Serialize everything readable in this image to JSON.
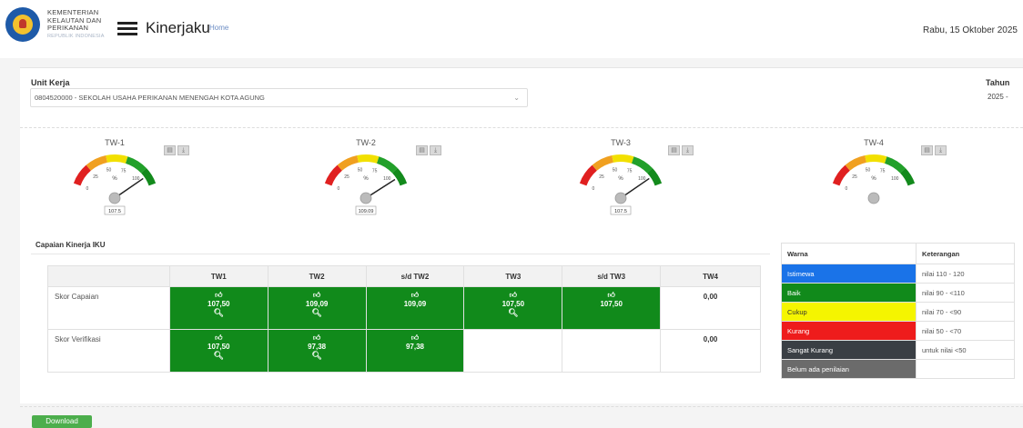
{
  "header": {
    "ministry_line1": "KEMENTERIAN",
    "ministry_line2": "KELAUTAN DAN",
    "ministry_line3": "PERIKANAN",
    "ministry_sub": "REPUBLIK INDONESIA",
    "app_title": "Kinerjaku",
    "breadcrumb": "Home",
    "date": "Rabu, 15 Oktober 2025",
    "icons": {
      "logo": "kkp-logo",
      "menu": "hamburger-menu-icon"
    }
  },
  "filters": {
    "unit_label": "Unit Kerja",
    "unit_value": "0804520000 - SEKOLAH USAHA PERIKANAN MENENGAH KOTA AGUNG",
    "tahun_label": "Tahun",
    "tahun_value": "2025 -"
  },
  "gauges": [
    {
      "title": "TW-1",
      "value": 107.5,
      "label": "107.5",
      "unit": "%",
      "ticks": [
        "0",
        "25",
        "50",
        "75",
        "100"
      ]
    },
    {
      "title": "TW-2",
      "value": 109.09,
      "label": "109.09",
      "unit": "%",
      "ticks": [
        "0",
        "25",
        "50",
        "75",
        "100"
      ]
    },
    {
      "title": "TW-3",
      "value": 107.5,
      "label": "107.5",
      "unit": "%",
      "ticks": [
        "0",
        "25",
        "50",
        "75",
        "100"
      ]
    },
    {
      "title": "TW-4",
      "value": null,
      "label": "",
      "unit": "%",
      "ticks": [
        "0",
        "25",
        "50",
        "75",
        "100"
      ]
    }
  ],
  "section": {
    "title": "Capaian Kinerja IKU"
  },
  "table": {
    "headers": [
      "",
      "TW1",
      "TW2",
      "s/d TW2",
      "TW3",
      "s/d TW3",
      "TW4"
    ],
    "rows": [
      {
        "label": "Skor Capaian",
        "cells": [
          {
            "value": "107,50",
            "color": "green",
            "search": true
          },
          {
            "value": "109,09",
            "color": "green",
            "search": true
          },
          {
            "value": "109,09",
            "color": "green",
            "search": false
          },
          {
            "value": "107,50",
            "color": "green",
            "search": true
          },
          {
            "value": "107,50",
            "color": "green",
            "search": false
          },
          {
            "value": "0,00",
            "color": "none",
            "search": false
          }
        ]
      },
      {
        "label": "Skor Verifikasi",
        "cells": [
          {
            "value": "107,50",
            "color": "green",
            "search": true
          },
          {
            "value": "97,38",
            "color": "green",
            "search": true
          },
          {
            "value": "97,38",
            "color": "green",
            "search": false
          },
          {
            "value": "",
            "color": "none",
            "search": false
          },
          {
            "value": "",
            "color": "none",
            "search": false
          },
          {
            "value": "0,00",
            "color": "none",
            "search": false
          }
        ]
      }
    ]
  },
  "legend": {
    "col_warna": "Warna",
    "col_keterangan": "Keterangan",
    "items": [
      {
        "label": "Istimewa",
        "desc": "nilai 110 - 120",
        "color": "#1a73e8",
        "text": "#ffffff"
      },
      {
        "label": "Baik",
        "desc": "nilai 90 - <110",
        "color": "#118a1b",
        "text": "#ffffff"
      },
      {
        "label": "Cukup",
        "desc": "nilai 70 - <90",
        "color": "#f5f500",
        "text": "#333333"
      },
      {
        "label": "Kurang",
        "desc": "nilai 50 - <70",
        "color": "#ee1c1c",
        "text": "#ffffff"
      },
      {
        "label": "Sangat Kurang",
        "desc": "untuk nilai <50",
        "color": "#3a3f44",
        "text": "#ffffff"
      },
      {
        "label": "Belum ada penilaian",
        "desc": "",
        "color": "#6b6b6b",
        "text": "#ffffff"
      }
    ]
  },
  "actions": {
    "download_label": "Download"
  },
  "colors": {
    "green": "#118a1b",
    "accent_blue": "#1a73e8"
  }
}
